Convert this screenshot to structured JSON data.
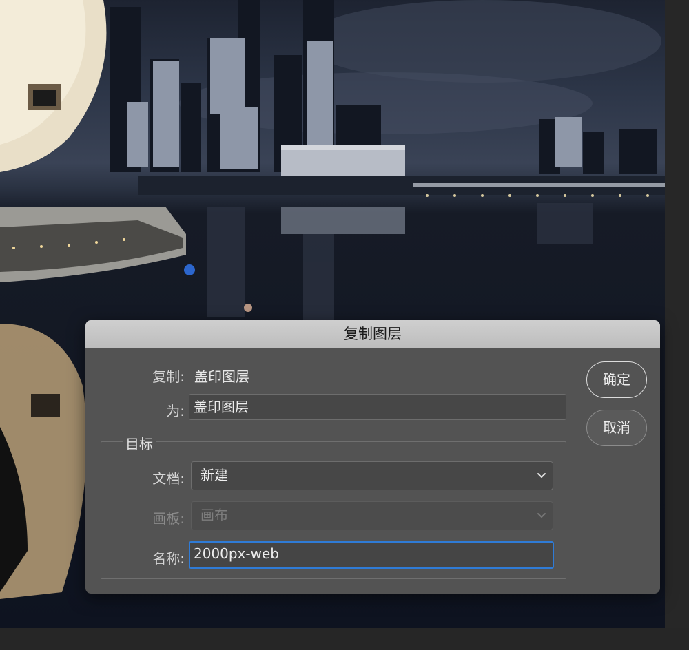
{
  "dialog": {
    "title": "复制图层",
    "duplicate_label": "复制:",
    "duplicate_value": "盖印图层",
    "as_label": "为:",
    "as_value": "盖印图层",
    "destination_group": "目标",
    "document_label": "文档:",
    "document_value": "新建",
    "artboard_label": "画板:",
    "artboard_value": "画布",
    "name_label": "名称:",
    "name_value": "2000px-web",
    "ok_button": "确定",
    "cancel_button": "取消"
  },
  "colors": {
    "dialog_bg": "#535353",
    "titlebar_bg": "#c6c6c6",
    "focus_ring": "#2f7bd6"
  },
  "icons": {
    "dropdown": "chevron-down-icon"
  }
}
